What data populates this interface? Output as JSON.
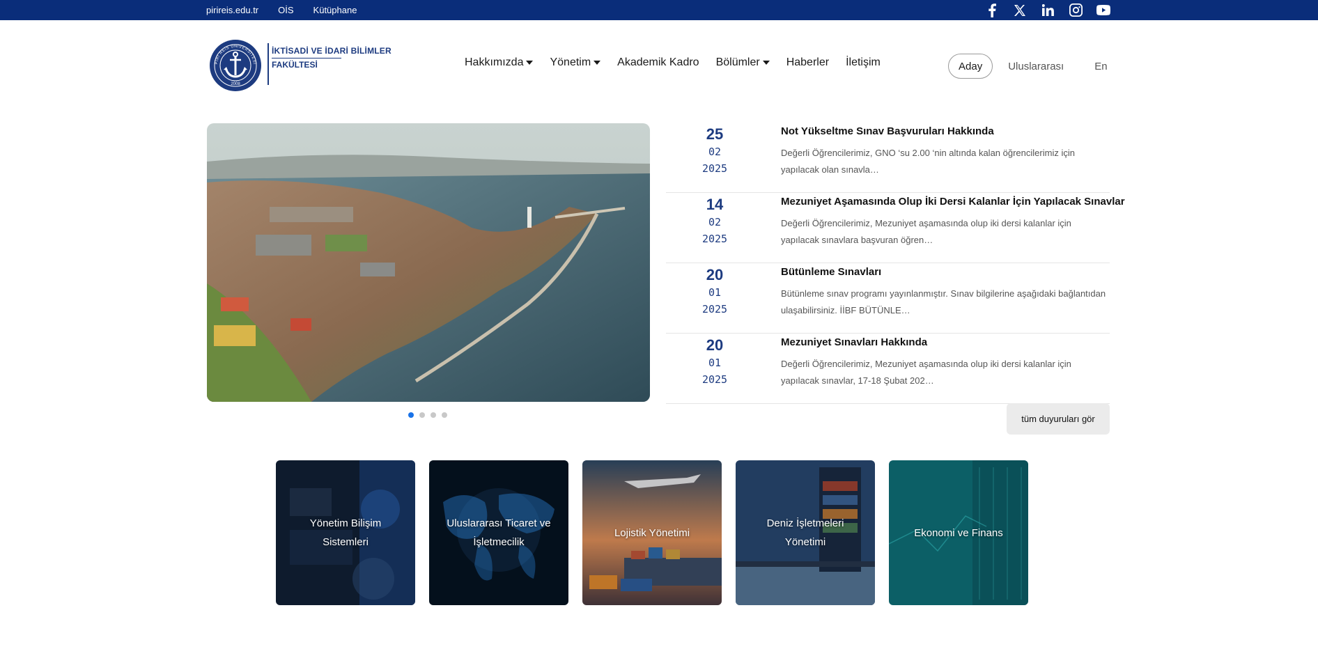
{
  "topbar": {
    "links": [
      "pirireis.edu.tr",
      "OİS",
      "Kütüphane"
    ],
    "social_icons": [
      "facebook-icon",
      "x-icon",
      "linkedin-icon",
      "instagram-icon",
      "youtube-icon"
    ],
    "background": "#0a2d7a"
  },
  "logo": {
    "line1": "İKTİSADİ VE İDARİ BİLİMLER",
    "line2": "FAKÜLTESİ",
    "seal_text": "PİRİ REİS ÜNİVERSİTESİ",
    "seal_year": "2008"
  },
  "nav": {
    "items": [
      {
        "label": "Hakkımızda",
        "dropdown": true
      },
      {
        "label": "Yönetim",
        "dropdown": true
      },
      {
        "label": "Akademik Kadro",
        "dropdown": false
      },
      {
        "label": "Bölümler",
        "dropdown": true
      },
      {
        "label": "Haberler",
        "dropdown": false
      },
      {
        "label": "İletişim",
        "dropdown": false
      }
    ],
    "aday": "Aday",
    "international": "Uluslararası",
    "lang": "En"
  },
  "slider": {
    "slides": 4,
    "active": 0
  },
  "announcements": [
    {
      "day": "25",
      "month": "02",
      "year": "2025",
      "title": "Not Yükseltme Sınav Başvuruları Hakkında",
      "excerpt": "Değerli Öğrencilerimiz, GNO ‘su 2.00 ‘nin altında kalan öğrencilerimiz için yapılacak olan sınavla…"
    },
    {
      "day": "14",
      "month": "02",
      "year": "2025",
      "title": "Mezuniyet Aşamasında Olup İki Dersi Kalanlar İçin Yapılacak Sınavlar",
      "excerpt": "Değerli Öğrencilerimiz, Mezuniyet aşamasında olup iki dersi kalanlar için yapılacak sınavlara başvuran öğren…"
    },
    {
      "day": "20",
      "month": "01",
      "year": "2025",
      "title": "Bütünleme Sınavları",
      "excerpt": "Bütünleme sınav programı yayınlanmıştır. Sınav bilgilerine aşağıdaki bağlantıdan ulaşabilirsiniz. İİBF BÜTÜNLE…"
    },
    {
      "day": "20",
      "month": "01",
      "year": "2025",
      "title": "Mezuniyet Sınavları Hakkında",
      "excerpt": "Değerli Öğrencilerimiz, Mezuniyet aşamasında olup iki dersi kalanlar için yapılacak sınavlar, 17-18 Şubat 202…"
    }
  ],
  "all_announcements_label": "tüm duyuruları gör",
  "departments": [
    {
      "label": "Yönetim Bilişim Sistemleri"
    },
    {
      "label": "Uluslararası Ticaret ve İşletmecilik"
    },
    {
      "label": "Lojistik Yönetimi"
    },
    {
      "label": "Deniz İşletmeleri Yönetimi"
    },
    {
      "label": "Ekonomi ve Finans"
    }
  ],
  "colors": {
    "brand": "#1d3b80",
    "active_dot": "#1a73e8"
  }
}
